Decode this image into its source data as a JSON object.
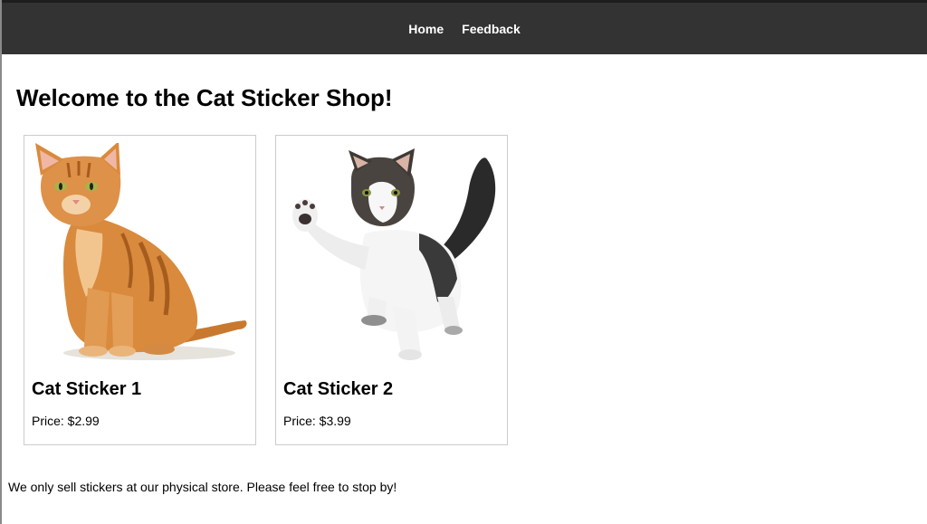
{
  "nav": {
    "home_label": "Home",
    "feedback_label": "Feedback"
  },
  "main": {
    "title": "Welcome to the Cat Sticker Shop!",
    "products": [
      {
        "name": "Cat Sticker 1",
        "price": "Price: $2.99",
        "image": "orange-tabby-cat-sitting"
      },
      {
        "name": "Cat Sticker 2",
        "price": "Price: $3.99",
        "image": "white-tabby-kitten-raising-paw"
      }
    ],
    "footer_note": "We only sell stickers at our physical store. Please feel free to stop by!"
  },
  "colors": {
    "navbar_bg": "#333333",
    "nav_text": "#ffffff",
    "card_border": "#cccccc"
  }
}
